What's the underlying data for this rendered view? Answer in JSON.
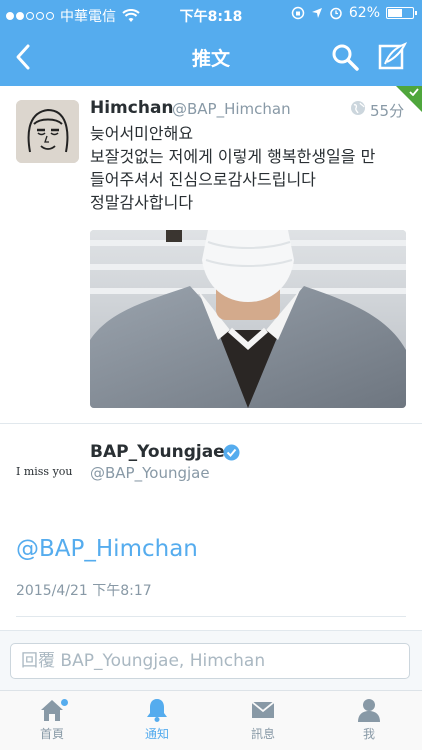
{
  "status_bar": {
    "carrier": "中華電信",
    "time": "下午8:18",
    "battery_text": "62%",
    "battery_level": 0.62
  },
  "nav": {
    "title": "推文"
  },
  "tweet": {
    "name": "Himchan",
    "handle": "@BAP_Himchan",
    "time": "55分",
    "lines": [
      "늦어서미안해요",
      "보잘것없는 저에게 이렇게  행복한생일을 만",
      "들어주셔서 진심으로감사드립니다",
      "정말감사합니다"
    ]
  },
  "reply_tweet": {
    "avatar_text": "I miss you",
    "name": "BAP_Youngjae",
    "handle": "@BAP_Youngjae",
    "mention": "@BAP_Himchan",
    "date": "2015/4/21 下午8:17"
  },
  "reply_bar": {
    "placeholder": "回覆 BAP_Youngjae, Himchan"
  },
  "tabs": [
    {
      "label": "首頁",
      "icon": "home-icon"
    },
    {
      "label": "通知",
      "icon": "bell-icon"
    },
    {
      "label": "訊息",
      "icon": "envelope-icon"
    },
    {
      "label": "我",
      "icon": "person-icon"
    }
  ],
  "colors": {
    "twitter_blue": "#55acee",
    "follow_green": "#4fa63c",
    "muted_text": "#8899a6"
  }
}
